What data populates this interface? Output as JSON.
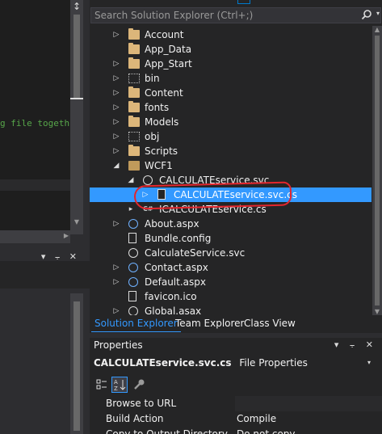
{
  "editor": {
    "code_fragment": "g file togeth",
    "split_glyph": "↕"
  },
  "lower_left": {
    "glyphs": "▾ ⨪ ✕"
  },
  "solution_explorer": {
    "search_placeholder": "Search Solution Explorer (Ctrl+;)",
    "tree": [
      {
        "label": "Account",
        "icon": "folder-icon",
        "expander": "▷"
      },
      {
        "label": "App_Data",
        "icon": "folder-icon",
        "expander": ""
      },
      {
        "label": "App_Start",
        "icon": "folder-icon",
        "expander": "▷"
      },
      {
        "label": "bin",
        "icon": "folder-dotted-icon",
        "expander": "▷"
      },
      {
        "label": "Content",
        "icon": "folder-icon",
        "expander": "▷"
      },
      {
        "label": "fonts",
        "icon": "folder-icon",
        "expander": "▷"
      },
      {
        "label": "Models",
        "icon": "folder-icon",
        "expander": "▷"
      },
      {
        "label": "obj",
        "icon": "folder-dotted-icon",
        "expander": "▷"
      },
      {
        "label": "Scripts",
        "icon": "folder-icon",
        "expander": "▷"
      },
      {
        "label": "WCF1",
        "icon": "folder-open-icon",
        "expander": "◢"
      },
      {
        "label": "CALCULATEservice.svc",
        "icon": "web-service-icon",
        "expander": "◢"
      },
      {
        "label": "CALCULATEservice.svc.cs",
        "icon": "cs-file-icon",
        "expander": "▷"
      },
      {
        "label": "ICALCULATEservice.cs",
        "icon": "cs-file-icon",
        "expander": "▸"
      },
      {
        "label": "About.aspx",
        "icon": "web-page-icon",
        "expander": "▷"
      },
      {
        "label": "Bundle.config",
        "icon": "config-file-icon",
        "expander": ""
      },
      {
        "label": "CalculateService.svc",
        "icon": "web-service-icon",
        "expander": ""
      },
      {
        "label": "Contact.aspx",
        "icon": "web-page-icon",
        "expander": "▷"
      },
      {
        "label": "Default.aspx",
        "icon": "web-page-icon",
        "expander": "▷"
      },
      {
        "label": "favicon.ico",
        "icon": "image-file-icon",
        "expander": ""
      },
      {
        "label": "Global.asax",
        "icon": "global-file-icon",
        "expander": "▷"
      }
    ],
    "selected_item": "CALCULATEservice.svc.cs",
    "csharp_badge": "C#",
    "tabs": [
      "Solution Explorer",
      "Team Explorer",
      "Class View"
    ],
    "active_tab": "Solution Explorer"
  },
  "properties": {
    "title": "Properties",
    "title_glyphs": "▾ ⨪ ✕",
    "object_name": "CALCULATEservice.svc.cs",
    "object_type": "File Properties",
    "rows": [
      {
        "name": "Browse to URL",
        "value": ""
      },
      {
        "name": "Build Action",
        "value": "Compile"
      },
      {
        "name": "Copy to Output Directory",
        "value": "Do not copy"
      }
    ]
  },
  "colors": {
    "accent": "#3399ff",
    "annotation": "#e3262d",
    "folder": "#dcb67a",
    "code_comment": "#57a64a"
  }
}
